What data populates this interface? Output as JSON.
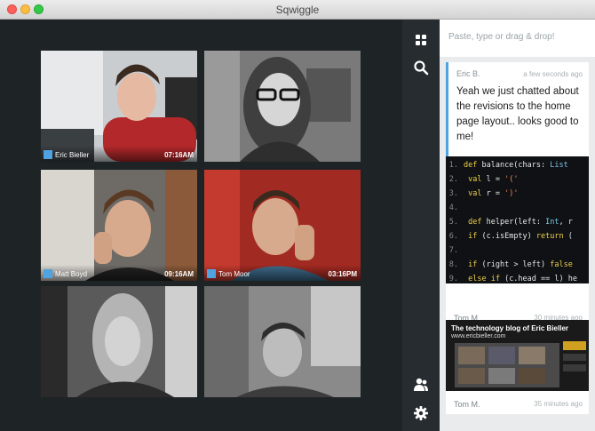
{
  "window": {
    "title": "Sqwiggle"
  },
  "tiles": [
    {
      "name": "Eric Bieller",
      "time": "07:16AM"
    },
    {
      "name": "",
      "time": ""
    },
    {
      "name": "Matt Boyd",
      "time": "09:16AM"
    },
    {
      "name": "Tom Moor",
      "time": "03:16PM"
    },
    {
      "name": "",
      "time": ""
    },
    {
      "name": "",
      "time": ""
    }
  ],
  "rail": {
    "icons": [
      "grid-icon",
      "search-icon",
      "people-icon",
      "gear-icon"
    ]
  },
  "panel": {
    "paste_placeholder": "Paste, type or drag & drop!",
    "message": {
      "author": "Eric B.",
      "time": "a few seconds ago",
      "text": "Yeah we just chatted about the revisions to the home page layout.. looks good to me!"
    },
    "code_post": {
      "author": "Tom M.",
      "time": "30 minutes ago",
      "lines": [
        "1.",
        "2.",
        "3.",
        "4.",
        "5.",
        "6.",
        "7.",
        "8.",
        "9."
      ]
    },
    "link_post": {
      "author": "Tom M.",
      "time": "35 minutes ago",
      "headline": "The technology blog of Eric Bieller",
      "url": "www.ericbieller.com"
    }
  },
  "colors": {
    "accent": "#4ea3e0"
  }
}
